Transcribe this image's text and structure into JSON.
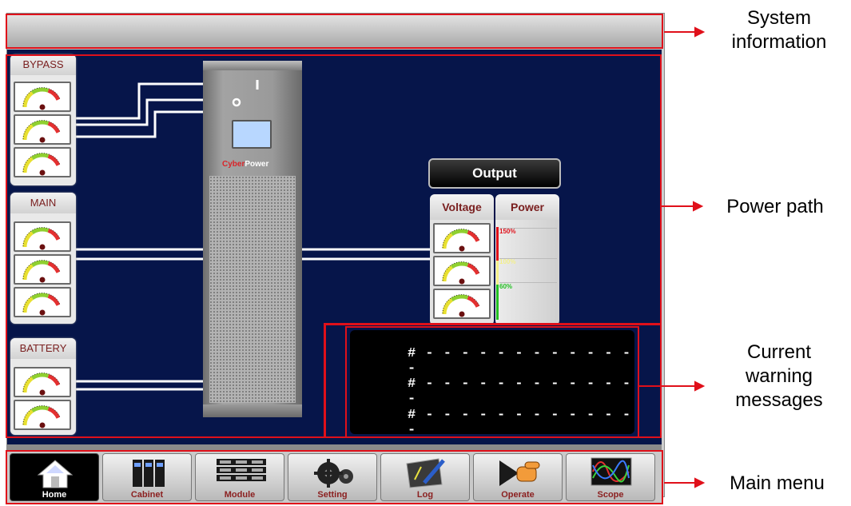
{
  "annotations": {
    "system_information": "System\ninformation",
    "power_path": "Power path",
    "current_warning": "Current\nwarning\nmessages",
    "main_menu": "Main menu"
  },
  "groups": {
    "bypass": {
      "label": "BYPASS"
    },
    "main": {
      "label": "MAIN"
    },
    "battery": {
      "label": "BATTERY"
    }
  },
  "output": {
    "title": "Output",
    "tabs": [
      "Voltage",
      "Power"
    ],
    "power_scale": [
      "150%",
      "100%",
      "60%"
    ]
  },
  "ups": {
    "brand_red": "Cyber",
    "brand_white": "Power"
  },
  "warnings": [
    "# - - - - - - - - - - - - -",
    "# - - - - - - - - - - - - -",
    "# - - - - - - - - - - - - -"
  ],
  "menu": [
    {
      "label": "Home",
      "icon": "home-icon"
    },
    {
      "label": "Cabinet",
      "icon": "cabinet-icon"
    },
    {
      "label": "Module",
      "icon": "module-icon"
    },
    {
      "label": "Setting",
      "icon": "gear-icon"
    },
    {
      "label": "Log",
      "icon": "log-icon"
    },
    {
      "label": "Operate",
      "icon": "operate-icon"
    },
    {
      "label": "Scope",
      "icon": "scope-icon"
    }
  ],
  "colors": {
    "panel": "#06154a",
    "highlight": "#e0101a",
    "label": "#7a2020"
  }
}
